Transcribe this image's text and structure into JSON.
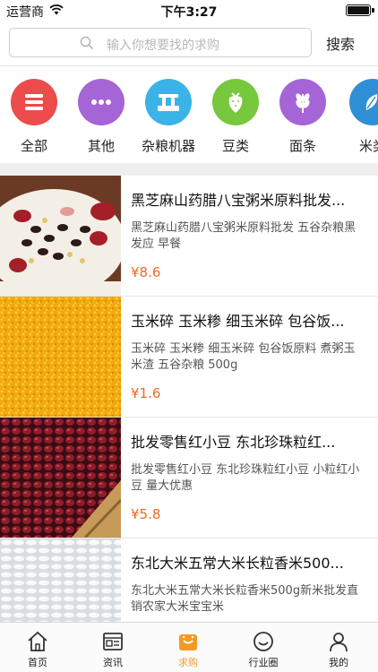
{
  "status_bar": {
    "carrier": "运营商",
    "time": "下午3:27"
  },
  "search": {
    "placeholder": "输入你想要找的求购",
    "button_label": "搜索"
  },
  "categories": [
    {
      "label": "全部",
      "icon": "menu-icon",
      "color": "#ec4c4c"
    },
    {
      "label": "其他",
      "icon": "more-dots-icon",
      "color": "#a565d6"
    },
    {
      "label": "杂粮机器",
      "icon": "machine-icon",
      "color": "#3ab3e6"
    },
    {
      "label": "豆类",
      "icon": "strawberry-icon",
      "color": "#77c83c"
    },
    {
      "label": "面条",
      "icon": "wheat-icon",
      "color": "#a565d6"
    },
    {
      "label": "米类",
      "icon": "rice-icon",
      "color": "#2e8fd6"
    }
  ],
  "products": [
    {
      "title": "黑芝麻山药腊八宝粥米原料批发...",
      "description": "黑芝麻山药腊八宝粥米原料批发 五谷杂粮黑发应 早餐",
      "price": "¥8.6",
      "image": "mixed-grains-image"
    },
    {
      "title": "玉米碎 玉米糁 细玉米碎 包谷饭...",
      "description": "玉米碎 玉米糁 细玉米碎 包谷饭原料 煮粥玉米渣 五谷杂粮 500g",
      "price": "¥1.6",
      "image": "corn-grits-image"
    },
    {
      "title": "批发零售红小豆 东北珍珠粒红...",
      "description": "批发零售红小豆 东北珍珠粒红小豆 小粒红小豆 量大优惠",
      "price": "¥5.8",
      "image": "red-beans-image"
    },
    {
      "title": "东北大米五常大米长粒香米500...",
      "description": "东北大米五常大米长粒香米500g新米批发直销农家大米宝宝米",
      "price": "",
      "image": "white-rice-image"
    }
  ],
  "tabs": [
    {
      "label": "首页",
      "icon": "home-icon",
      "active": false
    },
    {
      "label": "资讯",
      "icon": "news-icon",
      "active": false
    },
    {
      "label": "求购",
      "icon": "shopping-bag-icon",
      "active": true
    },
    {
      "label": "行业圈",
      "icon": "smile-icon",
      "active": false
    },
    {
      "label": "我的",
      "icon": "user-icon",
      "active": false
    }
  ],
  "colors": {
    "accent": "#f29b24",
    "price": "#ef6a1f"
  }
}
